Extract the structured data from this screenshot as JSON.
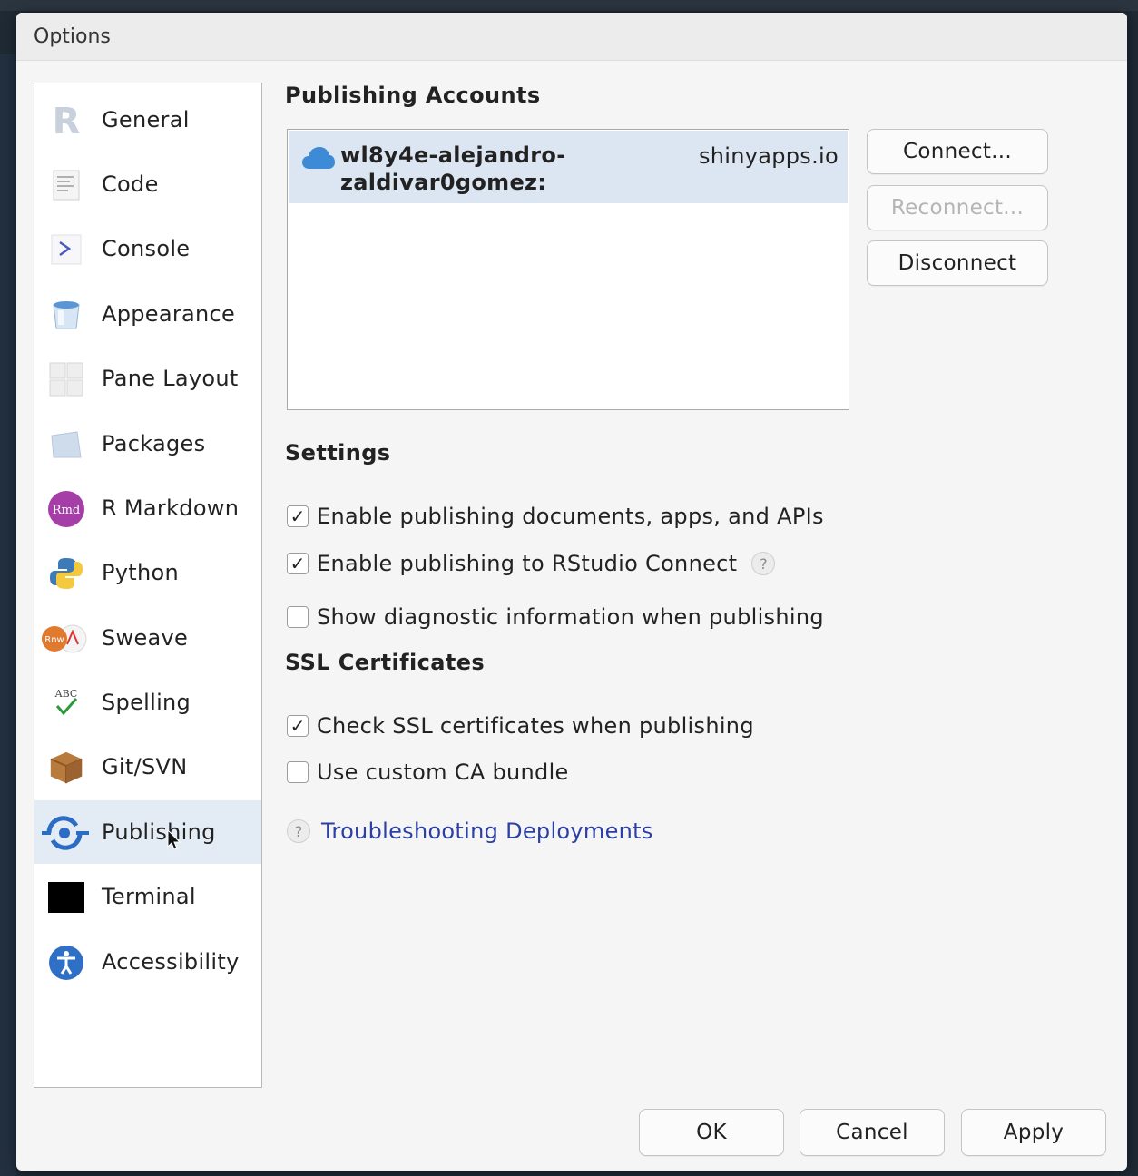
{
  "window": {
    "title": "Options"
  },
  "sidebar": {
    "items": [
      {
        "label": "General",
        "icon": "r-logo-icon"
      },
      {
        "label": "Code",
        "icon": "code-document-icon"
      },
      {
        "label": "Console",
        "icon": "console-prompt-icon"
      },
      {
        "label": "Appearance",
        "icon": "paint-bucket-icon"
      },
      {
        "label": "Pane Layout",
        "icon": "pane-layout-icon"
      },
      {
        "label": "Packages",
        "icon": "packages-icon"
      },
      {
        "label": "R Markdown",
        "icon": "rmd-icon",
        "icon_text": "Rmd"
      },
      {
        "label": "Python",
        "icon": "python-logo-icon"
      },
      {
        "label": "Sweave",
        "icon": "sweave-icon",
        "icon_text": "Rnw"
      },
      {
        "label": "Spelling",
        "icon": "spelling-check-icon",
        "icon_text": "ABC"
      },
      {
        "label": "Git/SVN",
        "icon": "git-box-icon"
      },
      {
        "label": "Publishing",
        "icon": "publishing-icon",
        "selected": true
      },
      {
        "label": "Terminal",
        "icon": "terminal-icon"
      },
      {
        "label": "Accessibility",
        "icon": "accessibility-icon"
      }
    ]
  },
  "publishing": {
    "accounts_title": "Publishing Accounts",
    "accounts": [
      {
        "name": "wl8y4e-alejandro-zaldivar0gomez:",
        "server": "shinyapps.io",
        "icon": "cloud-icon"
      }
    ],
    "buttons": {
      "connect": "Connect...",
      "reconnect": "Reconnect...",
      "disconnect": "Disconnect"
    },
    "settings_title": "Settings",
    "settings": [
      {
        "label": "Enable publishing documents, apps, and APIs",
        "checked": true
      },
      {
        "label": "Enable publishing to RStudio Connect",
        "checked": true,
        "help": true
      },
      {
        "label": "Show diagnostic information when publishing",
        "checked": false
      }
    ],
    "ssl_title": "SSL Certificates",
    "ssl": [
      {
        "label": "Check SSL certificates when publishing",
        "checked": true
      },
      {
        "label": "Use custom CA bundle",
        "checked": false
      }
    ],
    "troubleshooting_link": "Troubleshooting Deployments",
    "help_glyph": "?",
    "check_glyph": "✓"
  },
  "footer": {
    "ok": "OK",
    "cancel": "Cancel",
    "apply": "Apply"
  },
  "colors": {
    "selected_bg": "#e3ebf4",
    "link": "#2c3fa3",
    "account_row_bg": "#dce6f2"
  }
}
